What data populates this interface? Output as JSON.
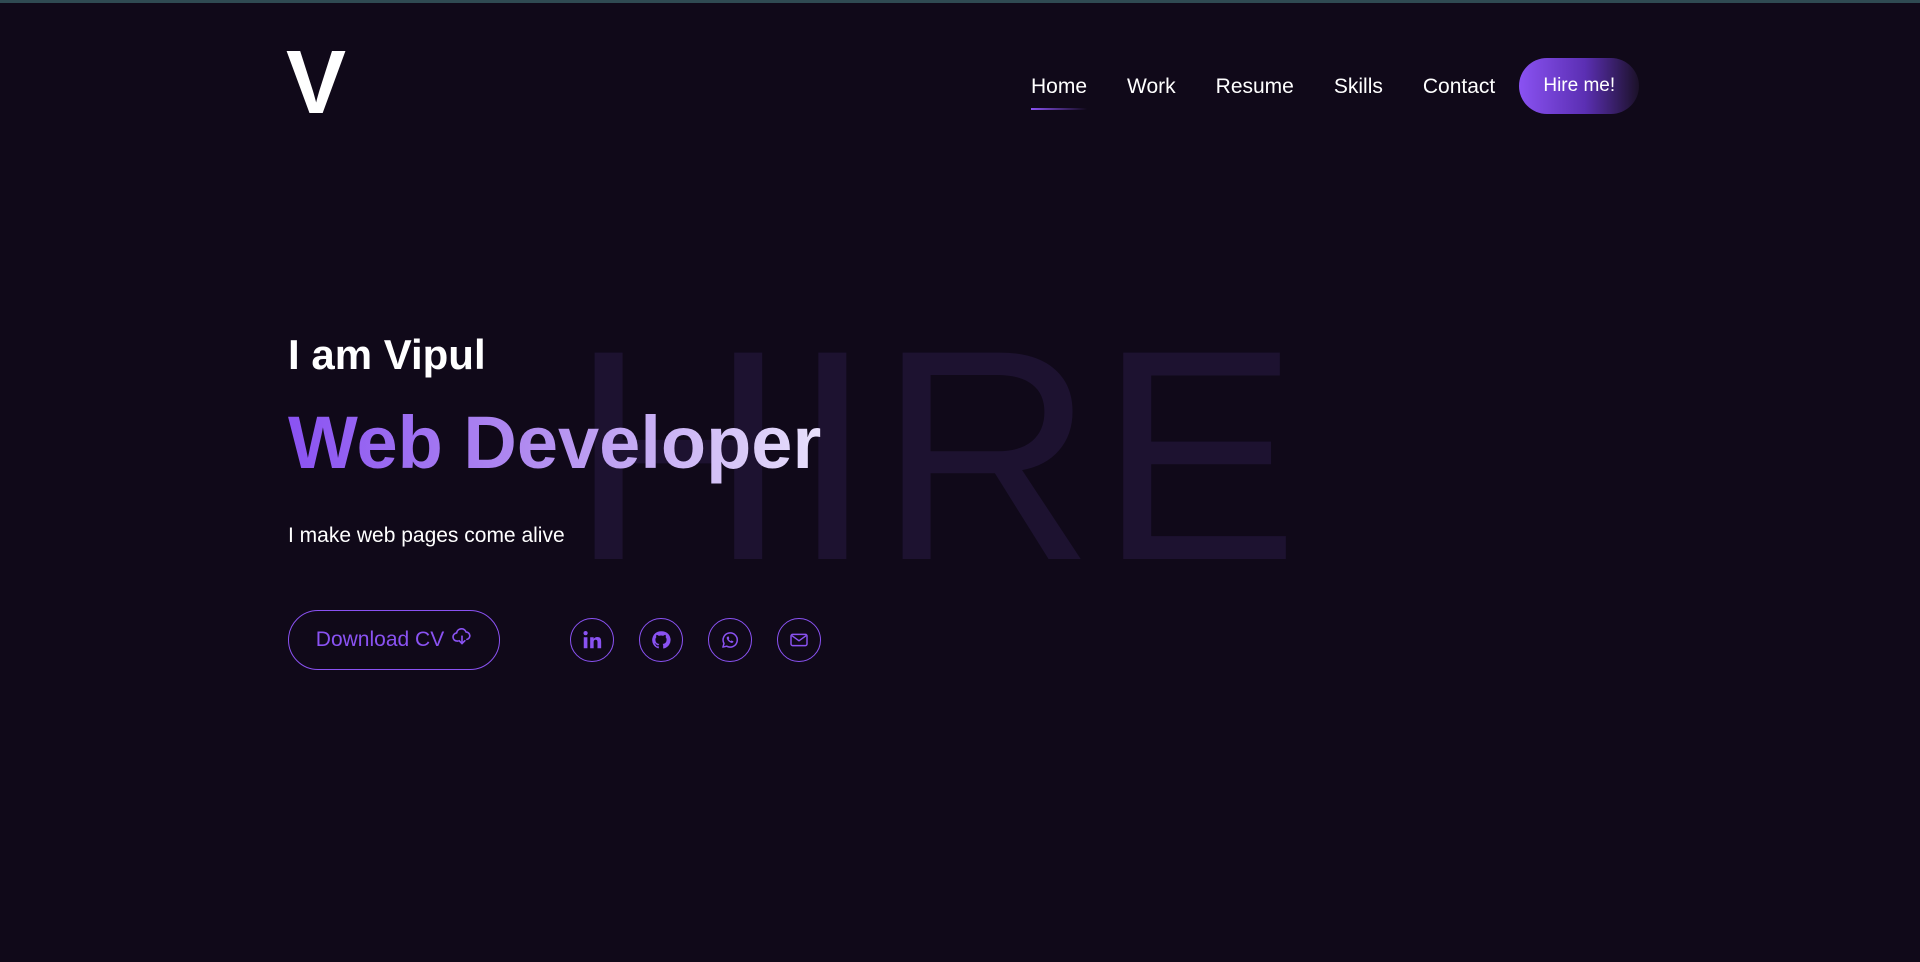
{
  "header": {
    "logo": "V",
    "nav": [
      {
        "label": "Home",
        "active": true
      },
      {
        "label": "Work",
        "active": false
      },
      {
        "label": "Resume",
        "active": false
      },
      {
        "label": "Skills",
        "active": false
      },
      {
        "label": "Contact",
        "active": false
      }
    ],
    "hire_button": "Hire me!"
  },
  "hero": {
    "watermark": "HIRE",
    "greeting": "I am Vipul",
    "role": "Web Developer",
    "tagline": "I make web pages come alive",
    "download_cv": "Download CV",
    "download_icon": "cloud-download-icon"
  },
  "socials": [
    {
      "name": "linkedin",
      "icon": "linkedin-icon"
    },
    {
      "name": "github",
      "icon": "github-icon"
    },
    {
      "name": "whatsapp",
      "icon": "whatsapp-icon"
    },
    {
      "name": "email",
      "icon": "mail-icon"
    }
  ],
  "colors": {
    "background": "#100919",
    "accent": "#8a52f2",
    "text": "#ffffff",
    "watermark": "#1d1230"
  }
}
